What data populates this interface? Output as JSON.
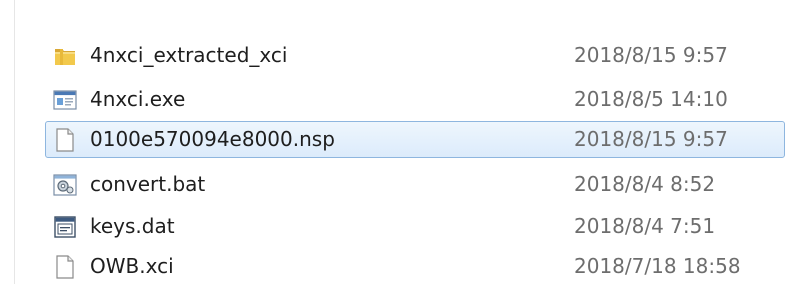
{
  "files": [
    {
      "name": "4nxci_extracted_xci",
      "date": "2018/8/15 9:57",
      "icon": "folder-icon"
    },
    {
      "name": "4nxci.exe",
      "date": "2018/8/5 14:10",
      "icon": "application-icon"
    },
    {
      "name": "0100e570094e8000.nsp",
      "date": "2018/8/15 9:57",
      "icon": "blank-file-icon",
      "selected": true
    },
    {
      "name": "convert.bat",
      "date": "2018/8/4 8:52",
      "icon": "batch-file-icon"
    },
    {
      "name": "keys.dat",
      "date": "2018/8/4 7:51",
      "icon": "dat-file-icon"
    },
    {
      "name": "OWB.xci",
      "date": "2018/7/18 18:58",
      "icon": "blank-file-icon"
    }
  ],
  "colors": {
    "selection_background": "#dcebfb",
    "selection_border": "#8eb6df",
    "name_text": "#1e1e1e",
    "date_text": "#6d6d6d"
  }
}
